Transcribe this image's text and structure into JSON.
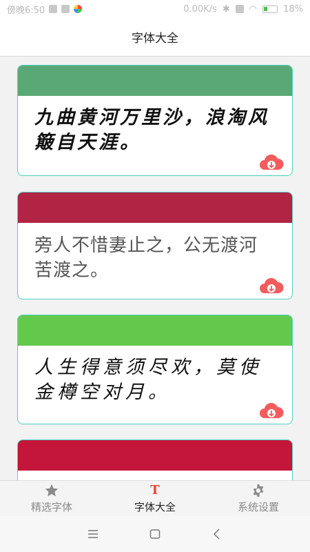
{
  "status_bar": {
    "time": "傍晚6:50",
    "network_speed": "0.00K/s",
    "battery_percent": "18%"
  },
  "header": {
    "title": "字体大全"
  },
  "cards": [
    {
      "text": "九曲黄河万里沙，浪淘风簸自天涯。",
      "head_color": "#5aa876",
      "style": "calli"
    },
    {
      "text": "旁人不惜妻止之，公无渡河苦渡之。",
      "head_color": "#b12443",
      "style": "thin"
    },
    {
      "text": "人生得意须尽欢，莫使金樽空对月。",
      "head_color": "#63c94c",
      "style": "hand"
    },
    {
      "text": "",
      "head_color": "#c4153a",
      "style": "calli"
    }
  ],
  "download_icon": "cloud-download-icon",
  "accent_color": "#f25c5c",
  "tabs": [
    {
      "label": "精选字体",
      "icon": "star-icon",
      "active": false
    },
    {
      "label": "字体大全",
      "icon": "font-t-icon",
      "active": true
    },
    {
      "label": "系统设置",
      "icon": "gear-icon",
      "active": false
    }
  ],
  "system_nav": {
    "menu_icon": "menu-icon",
    "home_icon": "home-square-icon",
    "back_icon": "back-chevron-icon"
  }
}
